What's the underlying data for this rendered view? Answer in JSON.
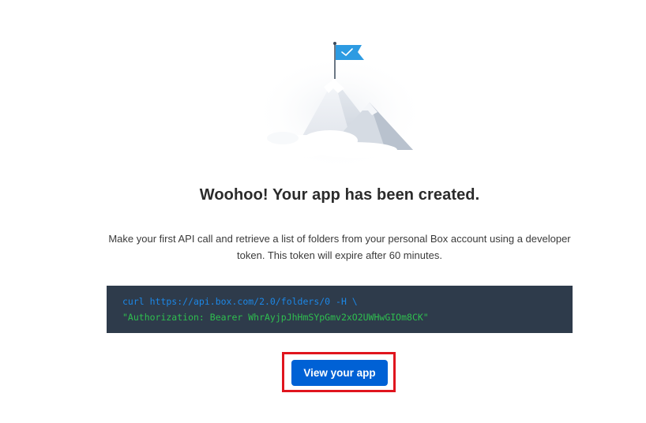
{
  "illustration": {
    "icon": "flag-on-mountain-icon",
    "flag_color": "#2d9be2"
  },
  "heading": "Woohoo! Your app has been created.",
  "description": "Make your first API call and retrieve a list of folders from your personal Box account using a developer token. This token will expire after 60 minutes.",
  "code": {
    "line1": "curl https://api.box.com/2.0/folders/0 -H \\",
    "line2": "\"Authorization: Bearer WhrAyjpJhHmSYpGmv2xO2UWHwGIOm8CK\"",
    "background_color": "#2e3b4b",
    "line1_color": "#1c87e6",
    "line2_color": "#2fbf4f"
  },
  "actions": {
    "view_app_label": "View your app",
    "button_color": "#0061d5",
    "highlight_color": "#e0151e"
  }
}
